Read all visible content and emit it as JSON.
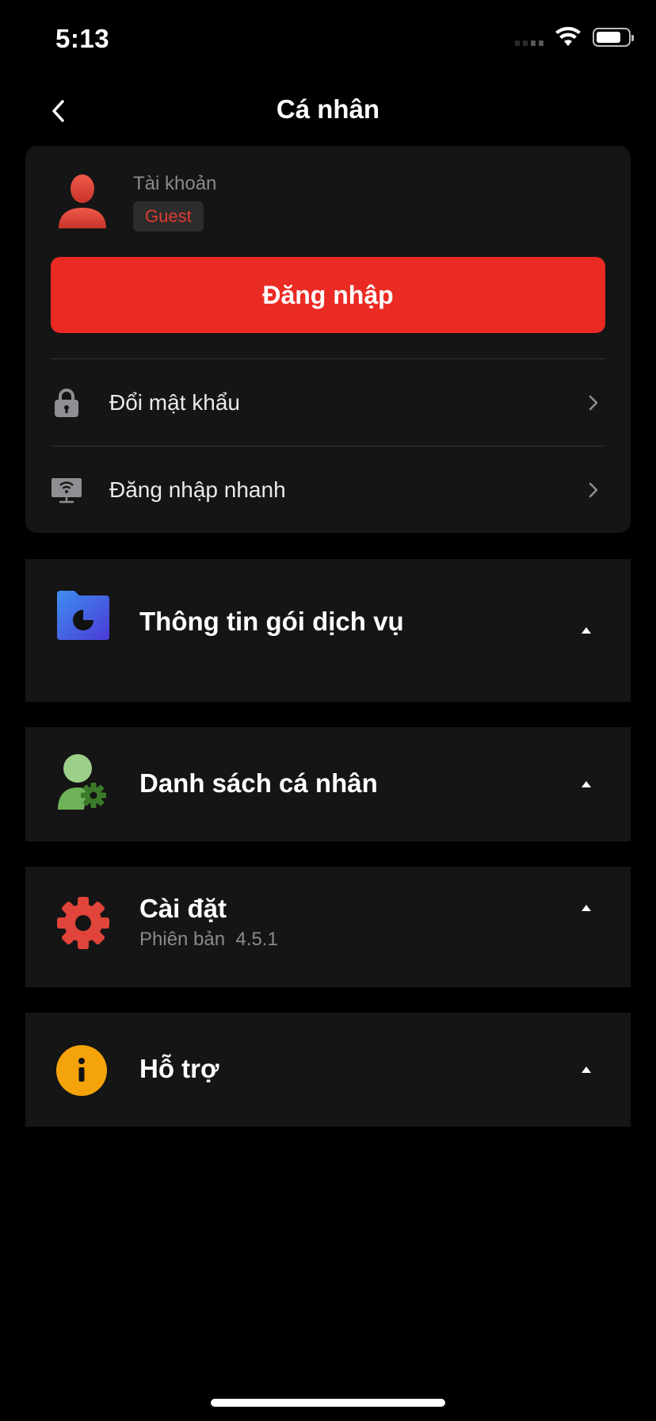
{
  "status": {
    "time": "5:13",
    "battery_level": 0.8
  },
  "nav": {
    "title": "Cá nhân",
    "back_icon": "chevron-left-icon"
  },
  "account": {
    "label": "Tài khoản",
    "badge": "Guest",
    "login_button": "Đăng nhập",
    "items": [
      {
        "label": "Đổi mật khẩu",
        "icon": "lock-icon"
      },
      {
        "label": "Đăng nhập nhanh",
        "icon": "tv-wifi-icon"
      }
    ]
  },
  "sections": [
    {
      "title": "Thông tin gói dịch vụ",
      "icon": "folder-pie-icon"
    },
    {
      "title": "Danh sách cá nhân",
      "icon": "user-settings-icon"
    },
    {
      "title": "Cài đặt",
      "subtitle": "Phiên bản  4.5.1",
      "icon": "gear-icon"
    },
    {
      "title": "Hỗ trợ",
      "icon": "info-icon"
    }
  ],
  "colors": {
    "accent": "#ea2b24",
    "card": "#151515",
    "background": "#000000",
    "muted": "#8a8a8a"
  }
}
